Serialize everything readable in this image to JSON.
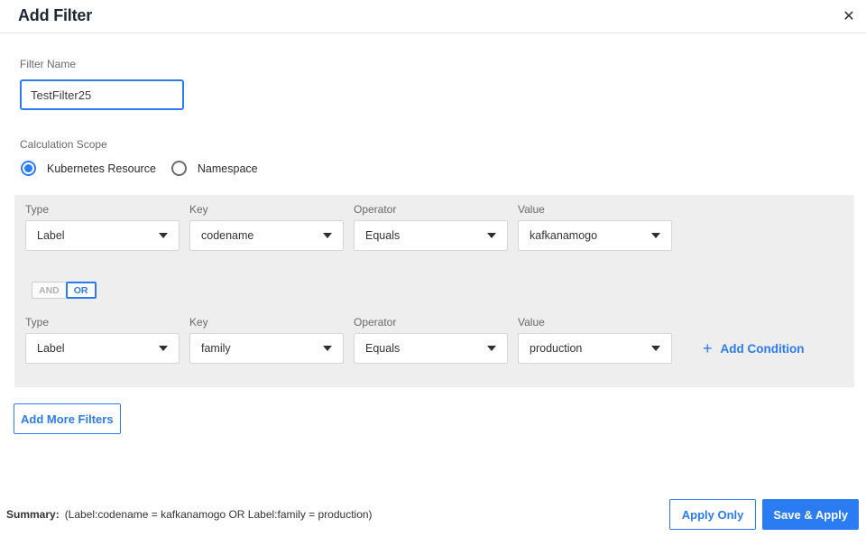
{
  "header": {
    "title": "Add Filter",
    "close_icon": "✕"
  },
  "filter_name": {
    "label": "Filter Name",
    "value": "TestFilter25"
  },
  "calculation_scope": {
    "label": "Calculation Scope",
    "options": [
      {
        "label": "Kubernetes Resource",
        "selected": true
      },
      {
        "label": "Namespace",
        "selected": false
      }
    ]
  },
  "conditions": {
    "column_labels": {
      "type": "Type",
      "key": "Key",
      "operator": "Operator",
      "value": "Value"
    },
    "rows": [
      {
        "type": "Label",
        "key": "codename",
        "operator": "Equals",
        "value": "kafkanamogo"
      },
      {
        "type": "Label",
        "key": "family",
        "operator": "Equals",
        "value": "production"
      }
    ],
    "join": {
      "options": [
        "AND",
        "OR"
      ],
      "selected": "OR"
    },
    "add_condition": {
      "plus_icon": "+",
      "label": "Add Condition"
    }
  },
  "add_more_filters_label": "Add More Filters",
  "footer": {
    "summary_label": "Summary:",
    "summary_text": "(Label:codename = kafkanamogo OR Label:family = production)",
    "apply_only_label": "Apply Only",
    "save_apply_label": "Save & Apply"
  },
  "colors": {
    "accent": "#2b7cf2",
    "panel_bg": "#eeeeee",
    "title_color": "#1d2633",
    "label_color": "#696969",
    "text_color": "#333333",
    "box_border": "#d6d6d6",
    "divider": "#e3e3e3"
  }
}
